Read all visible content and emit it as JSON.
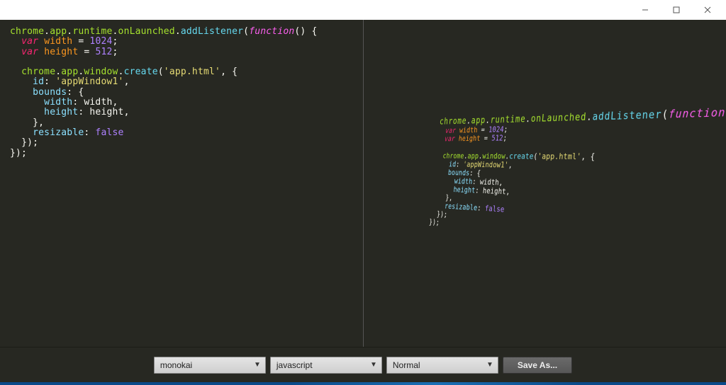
{
  "window": {
    "min_label": "",
    "max_label": "",
    "close_label": ""
  },
  "code": {
    "lines": [
      {
        "t": "chrome.app.runtime.onLaunched.addListener(function() {"
      },
      {
        "t": "  var width = 1024;"
      },
      {
        "t": "  var height = 512;"
      },
      {
        "t": ""
      },
      {
        "t": "  chrome.app.window.create('app.html', {"
      },
      {
        "t": "    id: 'appWindow1',"
      },
      {
        "t": "    bounds: {"
      },
      {
        "t": "      width: width,"
      },
      {
        "t": "      height: height,"
      },
      {
        "t": "    },"
      },
      {
        "t": "    resizable: false"
      },
      {
        "t": "  });"
      },
      {
        "t": "});"
      }
    ],
    "tokens": {
      "chrome": "chrome",
      "app": "app",
      "runtime": "runtime",
      "onLaunched": "onLaunched",
      "addListener": "addListener",
      "function_kw": "function",
      "var_kw": "var",
      "width_name": "width",
      "width_val": "1024",
      "height_name": "height",
      "height_val": "512",
      "window_word": "window",
      "create": "create",
      "app_html": "'app.html'",
      "id_key": "id",
      "id_val": "'appWindow1'",
      "bounds_key": "bounds",
      "width_key": "width",
      "height_key": "height",
      "resizable_key": "resizable",
      "false_val": "false"
    }
  },
  "toolbar": {
    "theme": "monokai",
    "language": "javascript",
    "mode": "Normal",
    "save_label": "Save As..."
  }
}
